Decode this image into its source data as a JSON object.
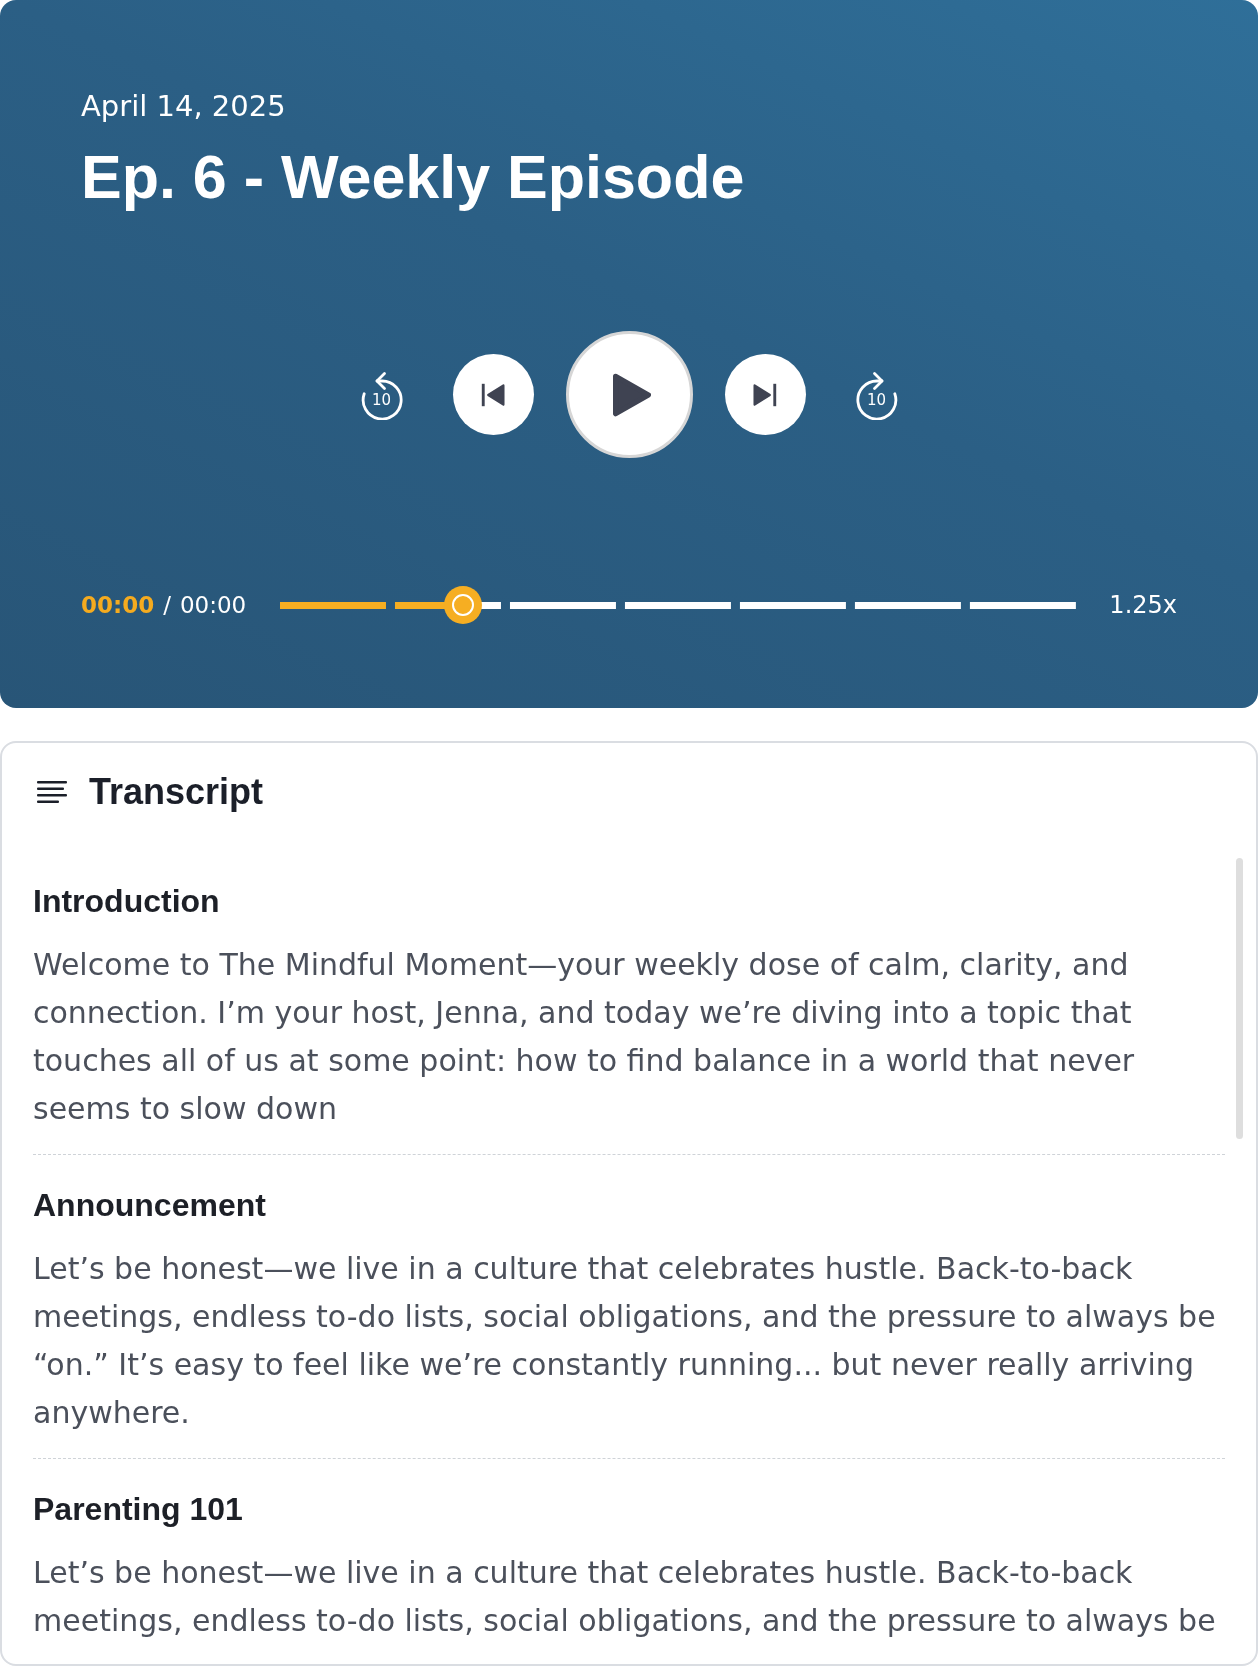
{
  "episode": {
    "date": "April 14, 2025",
    "title": "Ep. 6 - Weekly Episode"
  },
  "controls": [
    {
      "kind": "rewind",
      "label": "10"
    },
    {
      "kind": "previous"
    },
    {
      "kind": "play",
      "playing": false
    },
    {
      "kind": "next"
    },
    {
      "kind": "forward",
      "label": "10"
    }
  ],
  "progress": {
    "elapsed": "00:00",
    "separator": "/",
    "duration": "00:00",
    "level": 0.23
  },
  "speed": "1.25x",
  "transcript": {
    "title": "Transcript",
    "sections": [
      {
        "heading": "Introduction",
        "text": "Welcome to The Mindful Moment—your weekly dose of calm, clarity, and connection. I’m your host, Jenna, and today we’re diving into a topic that touches all of us at some point: how to find balance in a world that never seems to slow down"
      },
      {
        "heading": "Announcement",
        "text": "Let’s be honest—we live in a culture that celebrates hustle. Back-to-back meetings, endless to-do lists, social obligations, and the pressure to always be “on.” It’s easy to feel like we’re constantly running... but never really arriving anywhere."
      },
      {
        "heading": "Parenting 101",
        "text": "Let’s be honest—we live in a culture that celebrates hustle. Back-to-back meetings, endless to-do lists, social obligations, and the pressure to always be"
      }
    ]
  }
}
